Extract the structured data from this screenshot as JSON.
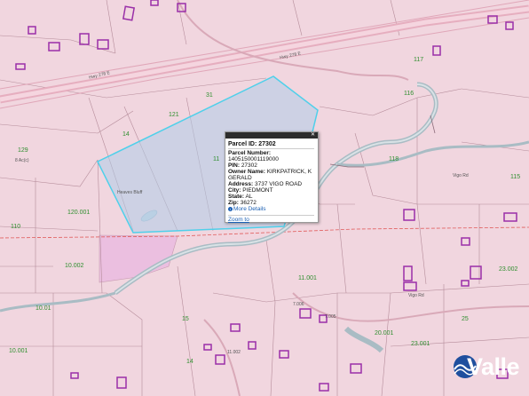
{
  "map": {
    "road_labels": [
      "Hwy 278 E",
      "Hwy 278 E"
    ],
    "parcel_labels_green": [
      "129",
      "121",
      "14",
      "11",
      "118",
      "115",
      "12",
      "120.001",
      "110",
      "10.002",
      "11.001",
      "15",
      "10.001",
      "20.001",
      "23.001",
      "23.002",
      "25",
      "117",
      "116",
      "31",
      "10.01",
      "14"
    ],
    "parcel_labels_grey": [
      "8 Ac(c)",
      "Hwy 278 E",
      "Hwy 278 E",
      "Heaves Bluff",
      "Hwy 278",
      "Vigo Rd",
      "Vigo Rd",
      "7.005",
      "7.006",
      "11.002"
    ]
  },
  "popup": {
    "title": "Parcel ID: 27302",
    "fields": [
      {
        "label": "Parcel Number:",
        "value": ""
      },
      {
        "label": "",
        "value": "1405150001119000"
      },
      {
        "label": "PIN:",
        "value": "27302"
      },
      {
        "label": "Owner Name:",
        "value": "KIRKPATRICK, K GERALD"
      },
      {
        "label": "Address:",
        "value": "3737 VIGO ROAD"
      },
      {
        "label": "City:",
        "value": "PIEDMONT"
      },
      {
        "label": "State:",
        "value": "AL"
      },
      {
        "label": "Zip:",
        "value": "36272"
      }
    ],
    "more_details": "More Details",
    "zoom_to": "Zoom to",
    "close_label": "✕"
  },
  "logo": {
    "text": "Valle"
  },
  "colors": {
    "background": "#f1d6df",
    "parcel_line": "#b58c9a",
    "building": "#9a2fa8",
    "selected_parcel": "#5bc8e6",
    "road": "#e0a6b8",
    "river": "#a9bcc4",
    "boundary": "#e05a5a"
  }
}
